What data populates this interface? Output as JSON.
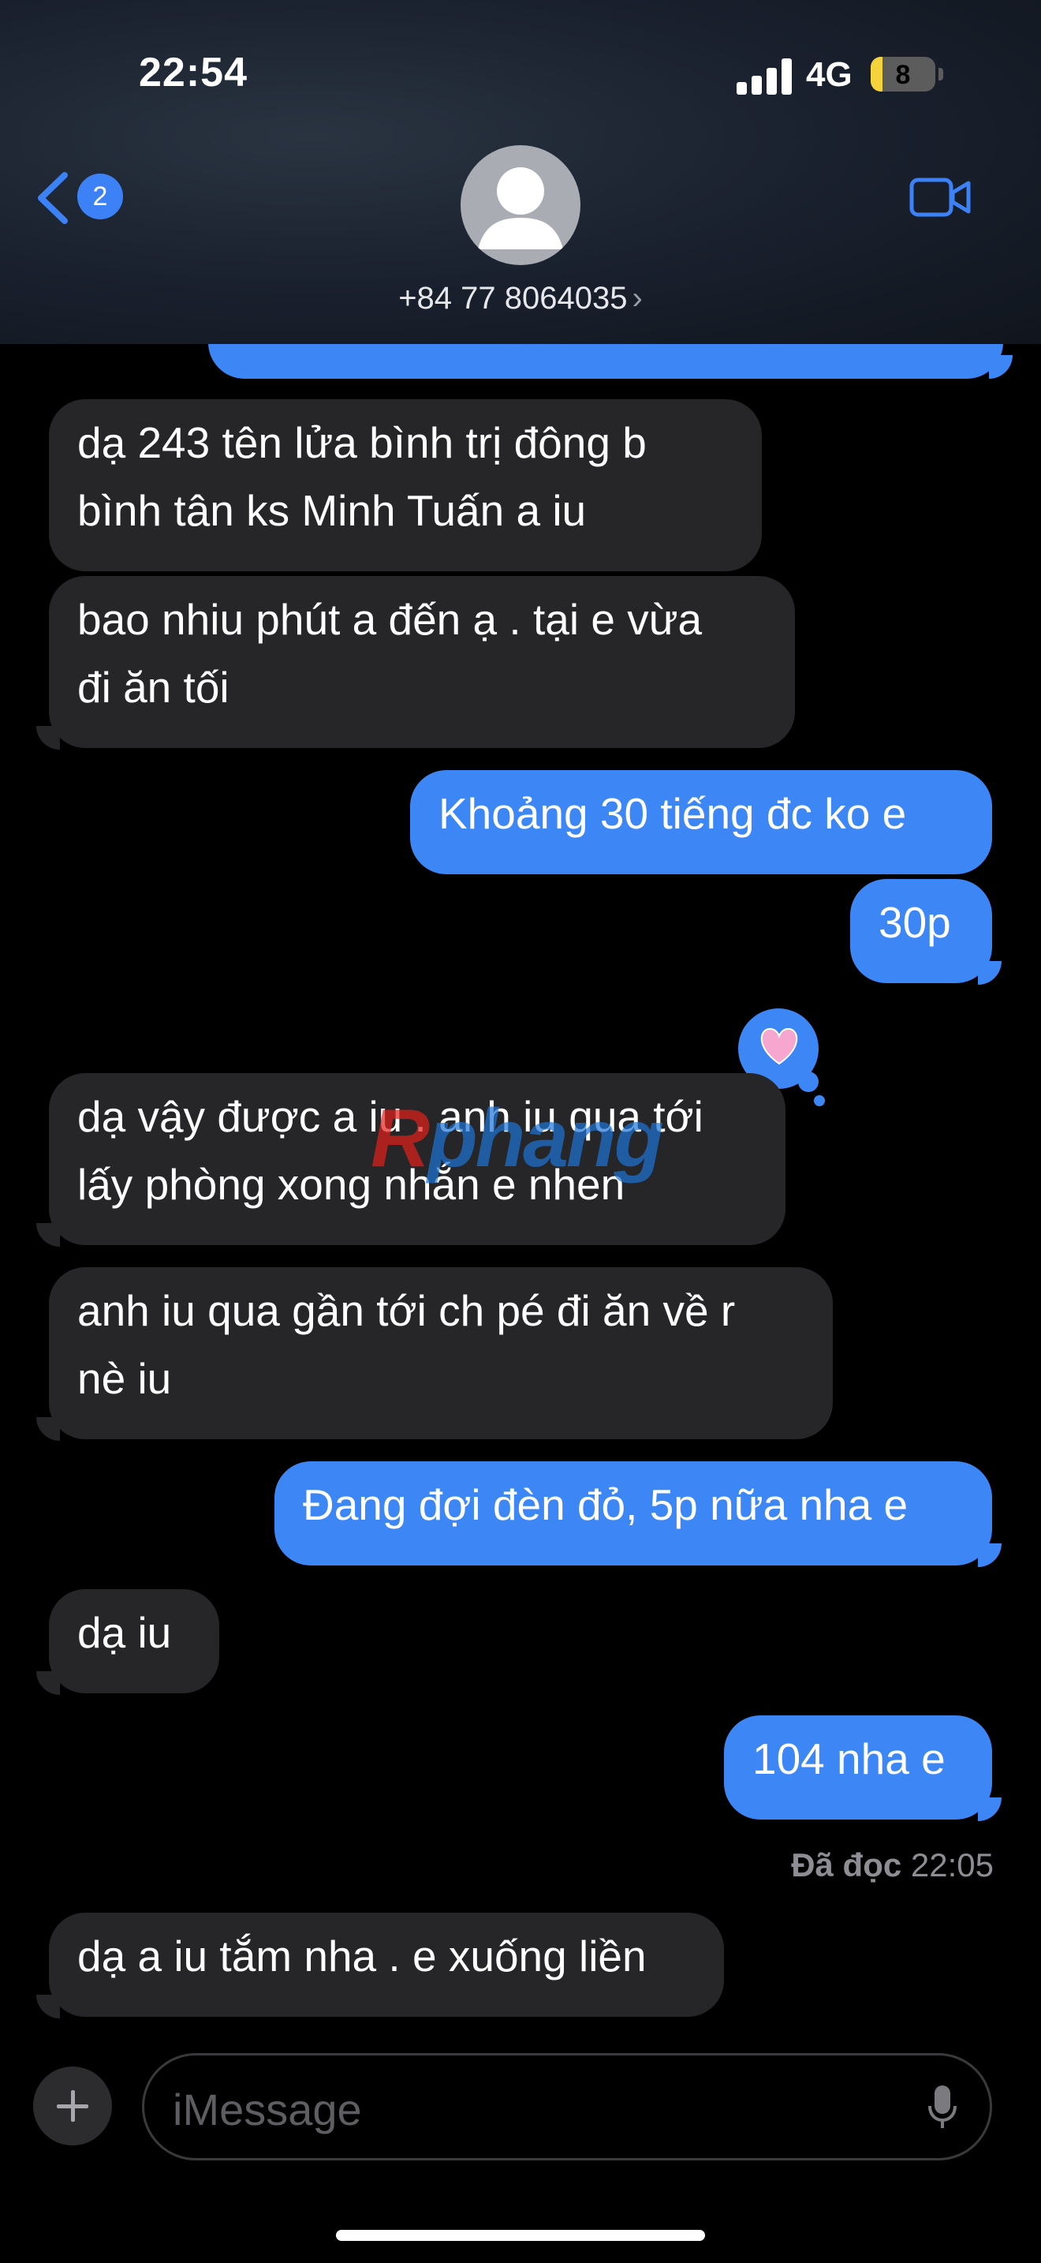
{
  "status": {
    "time": "22:54",
    "network": "4G",
    "battery": "8",
    "battery_level_percent": 18
  },
  "nav": {
    "back_badge": "2",
    "contact": "+84 77 8064035",
    "contact_chevron": "›"
  },
  "messages": [
    {
      "dir": "in",
      "lines": [
        " dạ 243 tên lửa bình trị đông b",
        "bình tân ks Minh Tuấn a iu"
      ]
    },
    {
      "dir": "in",
      "lines": [
        "bao nhiu phút a đến ạ . tại e vừa",
        "đi ăn tối"
      ]
    },
    {
      "dir": "out",
      "lines": [
        "Khoảng 30 tiếng đc ko e"
      ]
    },
    {
      "dir": "out",
      "lines": [
        "30p"
      ]
    },
    {
      "dir": "in",
      "lines": [
        "dạ vậy được a iu . anh iu qua tới",
        "lấy phòng xong nhắn e nhen"
      ]
    },
    {
      "dir": "in",
      "lines": [
        "anh iu qua gần tới ch pé đi ăn về r",
        "nè iu"
      ]
    },
    {
      "dir": "out",
      "lines": [
        "Đang đợi đèn đỏ, 5p nữa nha e"
      ]
    },
    {
      "dir": "in",
      "lines": [
        "dạ iu"
      ]
    },
    {
      "dir": "out",
      "lines": [
        "104 nha e"
      ]
    },
    {
      "dir": "in",
      "lines": [
        "dạ a iu tắm nha . e xuống liền"
      ]
    }
  ],
  "read_receipt": {
    "label": "Đã đọc",
    "time": "22:05"
  },
  "tapback": {
    "icon": "pink-heart-icon"
  },
  "watermark": {
    "part1": "R",
    "part2": "phang"
  },
  "input": {
    "placeholder": "iMessage"
  },
  "colors": {
    "outgoing": "#3c87f5",
    "incoming": "#262628",
    "background": "#000000"
  }
}
